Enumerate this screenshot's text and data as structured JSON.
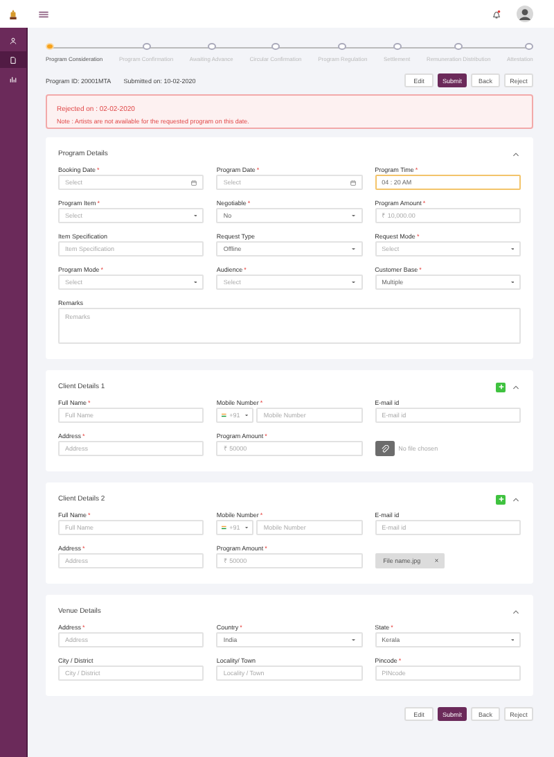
{
  "sidebar": {
    "items": [
      {
        "selected": false
      },
      {
        "selected": true
      },
      {
        "selected": false
      }
    ]
  },
  "steps": [
    {
      "label": "Program Consideration",
      "selected": true
    },
    {
      "label": "Program Confirmation",
      "selected": false
    },
    {
      "label": "Awaiting Advance",
      "selected": false
    },
    {
      "label": "Circular Confirmation",
      "selected": false
    },
    {
      "label": "Program Regulation",
      "selected": false
    },
    {
      "label": "Settlement",
      "selected": false
    },
    {
      "label": "Remuneration Distribution",
      "selected": false
    },
    {
      "label": "Attestation",
      "selected": false
    }
  ],
  "program_id": "Program ID: 20001MTA",
  "submitted_on": "Submitted on: 10-02-2020",
  "actions": [
    {
      "label": "Edit",
      "kind": "plain"
    },
    {
      "label": "Submit",
      "kind": "primary"
    },
    {
      "label": "Back",
      "kind": "plain"
    },
    {
      "label": "Reject",
      "kind": "plain"
    }
  ],
  "alert": {
    "title": "Rejected on : 02-02-2020",
    "note": "Note : Artists are not available for the requested program on this date."
  },
  "sections": [
    {
      "title": "Program Details",
      "expanded": true,
      "add_button": false,
      "fields": [
        {
          "kind": "date",
          "label": "Booking Date",
          "mark": "*",
          "placeholder": "Select",
          "focused": false
        },
        {
          "kind": "date",
          "label": "Program Date",
          "mark": "*",
          "placeholder": "Select",
          "focused": false
        },
        {
          "kind": "time",
          "label": "Program Time",
          "mark": "*",
          "value": "04 : 20 AM",
          "focused": true
        },
        {
          "kind": "select",
          "label": "Program Item",
          "mark": "*",
          "placeholder": "Select",
          "focused": false
        },
        {
          "kind": "select",
          "label": "Negotiable",
          "mark": "*",
          "value": "No",
          "focused": false
        },
        {
          "kind": "text",
          "label": "Program Amount",
          "mark": "*",
          "placeholder": "₹ 10,000.00",
          "focused": false
        },
        {
          "kind": "text",
          "label": "Item Specification",
          "placeholder": "Item Specification",
          "focused": false
        },
        {
          "kind": "select",
          "label": "Request Type",
          "value": "Offline",
          "focused": false
        },
        {
          "kind": "select",
          "label": "Request Mode",
          "mark": "*",
          "placeholder": "Select",
          "focused": false
        },
        {
          "kind": "select",
          "label": "Program Mode",
          "mark": "*",
          "placeholder": "Select",
          "focused": false
        },
        {
          "kind": "select",
          "label": "Audience",
          "mark": "*",
          "placeholder": "Select",
          "focused": false
        },
        {
          "kind": "select",
          "label": "Customer Base",
          "mark": "*",
          "value": "Multiple",
          "focused": false
        },
        {
          "kind": "textarea",
          "label": "Remarks",
          "placeholder": "Remarks",
          "focused": false
        }
      ]
    },
    {
      "title": "Client Details 1",
      "expanded": true,
      "add_button": true,
      "fields": [
        {
          "kind": "text",
          "label": "Full Name",
          "mark": "*",
          "placeholder": "Full Name",
          "focused": false
        },
        {
          "kind": "phone",
          "label": "Mobile Number",
          "mark": "*",
          "code": "+91",
          "placeholder": "Mobile Number",
          "focused": false
        },
        {
          "kind": "text",
          "label": "E-mail id",
          "placeholder": "E-mail id",
          "focused": false
        },
        {
          "kind": "text",
          "label": "Address",
          "mark": "*",
          "placeholder": "Address",
          "focused": false
        },
        {
          "kind": "text",
          "label": "Program  Amount",
          "mark": "*",
          "placeholder": "₹ 50000",
          "focused": false
        },
        {
          "kind": "file",
          "text": "No file chosen",
          "focused": false
        }
      ]
    },
    {
      "title": "Client Details 2",
      "expanded": true,
      "add_button": true,
      "fields": [
        {
          "kind": "text",
          "label": "Full Name",
          "mark": "*",
          "placeholder": "Full Name",
          "focused": false
        },
        {
          "kind": "phone",
          "label": "Mobile Number",
          "mark": "*",
          "code": "+91",
          "placeholder": "Mobile Number",
          "focused": false
        },
        {
          "kind": "text",
          "label": "E-mail id",
          "placeholder": "E-mail id",
          "focused": false
        },
        {
          "kind": "text",
          "label": "Address",
          "mark": "*",
          "placeholder": "Address",
          "focused": false
        },
        {
          "kind": "text",
          "label": "Program  Amount",
          "mark": "*",
          "placeholder": "₹ 50000",
          "focused": false
        },
        {
          "kind": "file-chosen",
          "file_name": "File name.jpg",
          "focused": false
        }
      ]
    },
    {
      "title": "Venue Details",
      "expanded": true,
      "add_button": false,
      "fields": [
        {
          "kind": "text",
          "label": "Address",
          "mark": "*",
          "placeholder": "Address",
          "focused": false
        },
        {
          "kind": "select",
          "label": "Country",
          "mark": "*",
          "value": "India",
          "focused": false
        },
        {
          "kind": "select",
          "label": "State",
          "mark": "*",
          "value": "Kerala",
          "focused": false
        },
        {
          "kind": "text",
          "label": "City / District",
          "placeholder": "City / District",
          "focused": false
        },
        {
          "kind": "text",
          "label": "Locality/ Town",
          "placeholder": "Locality / Town",
          "focused": false
        },
        {
          "kind": "text",
          "label": "Pincode",
          "mark": "*",
          "placeholder": "PINcode",
          "focused": false
        }
      ]
    }
  ],
  "footer_actions": [
    {
      "label": "Edit",
      "kind": "plain"
    },
    {
      "label": "Submit",
      "kind": "primary"
    },
    {
      "label": "Back",
      "kind": "plain"
    },
    {
      "label": "Reject",
      "kind": "plain"
    }
  ]
}
